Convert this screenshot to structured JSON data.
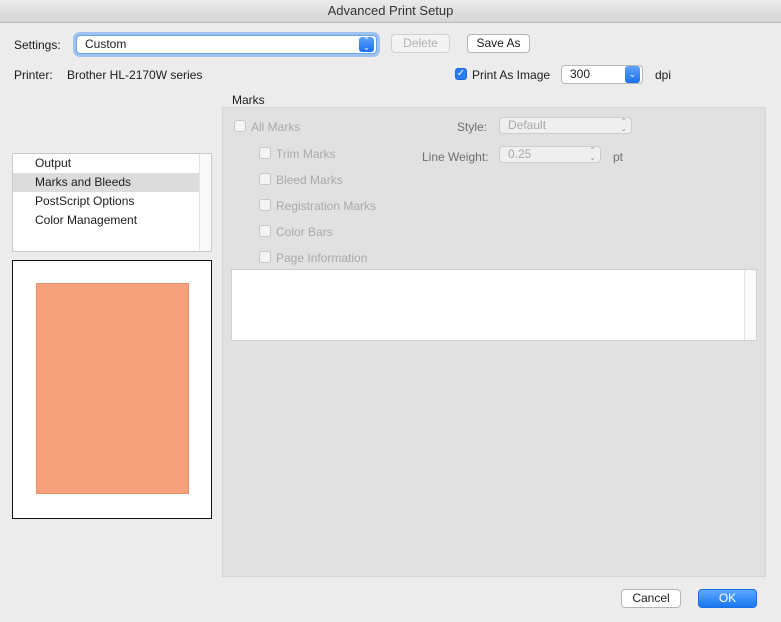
{
  "window": {
    "title": "Advanced Print Setup"
  },
  "settings": {
    "label": "Settings:",
    "value": "Custom"
  },
  "buttons": {
    "delete": "Delete",
    "save_as": "Save As",
    "cancel": "Cancel",
    "ok": "OK"
  },
  "printer": {
    "label": "Printer:",
    "name": "Brother HL-2170W series"
  },
  "print_as_image": {
    "label": "Print As Image",
    "checked": true,
    "dpi_value": "300",
    "dpi_unit": "dpi"
  },
  "sidebar": {
    "items": [
      "Output",
      "Marks and Bleeds",
      "PostScript Options",
      "Color Management"
    ],
    "selected": "Marks and Bleeds"
  },
  "marks": {
    "section_title": "Marks",
    "all_marks": "All Marks",
    "options": [
      "Trim Marks",
      "Bleed Marks",
      "Registration Marks",
      "Color Bars",
      "Page Information"
    ],
    "style_label": "Style:",
    "style_value": "Default",
    "line_weight_label": "Line Weight:",
    "line_weight_value": "0.25",
    "line_weight_unit": "pt"
  },
  "colors": {
    "accent": "#1877f2",
    "preview_page": "#f6a07c"
  }
}
